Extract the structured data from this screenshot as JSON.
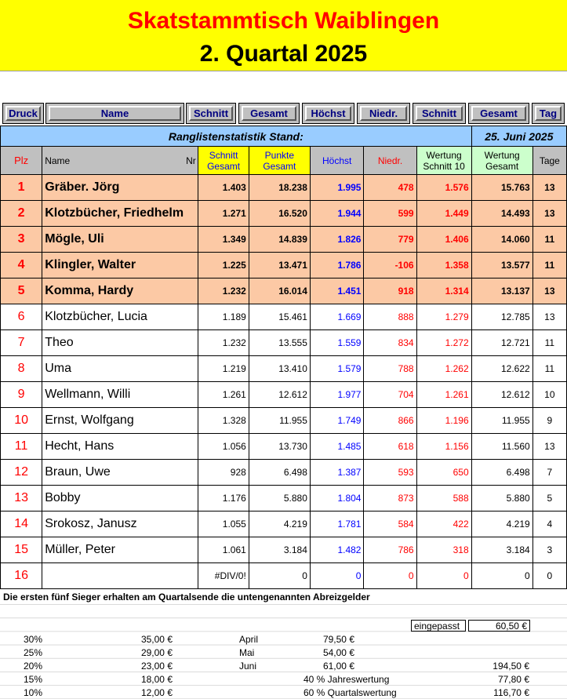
{
  "title": {
    "line1": "Skatstammtisch Waiblingen",
    "line2": "2. Quartal 2025"
  },
  "buttons": [
    "Druck",
    "Name",
    "Schnitt",
    "Gesamt",
    "Höchst",
    "Niedr.",
    "Schnitt",
    "Gesamt",
    "Tag"
  ],
  "stand": {
    "label": "Ranglistenstatistik Stand:",
    "date": "25. Juni 2025"
  },
  "headers": {
    "plz": "Plz",
    "name": "Name",
    "nr": "Nr",
    "schnitt": [
      "Schnitt",
      "Gesamt"
    ],
    "punkte": [
      "Punkte",
      "Gesamt"
    ],
    "hoechst": "Höchst",
    "niedr": "Niedr.",
    "wschnitt": [
      "Wertung",
      "Schnitt 10"
    ],
    "wgesamt": [
      "Wertung",
      "Gesamt"
    ],
    "tage": "Tage"
  },
  "colors": {
    "title_bg": "#ffff00",
    "title_red": "#ff0000",
    "header_blue": "#99ccff",
    "top5_bg": "#fcc9a5",
    "yellow": "#ffff00",
    "green": "#ccffcc"
  },
  "rows": [
    {
      "plz": "1",
      "name": "Gräber. Jörg",
      "schnitt": "1.403",
      "punkte": "18.238",
      "hoechst": "1.995",
      "niedr": "478",
      "wschnitt": "1.576",
      "wgesamt": "15.763",
      "tage": "13"
    },
    {
      "plz": "2",
      "name": "Klotzbücher, Friedhelm",
      "schnitt": "1.271",
      "punkte": "16.520",
      "hoechst": "1.944",
      "niedr": "599",
      "wschnitt": "1.449",
      "wgesamt": "14.493",
      "tage": "13"
    },
    {
      "plz": "3",
      "name": "Mögle, Uli",
      "schnitt": "1.349",
      "punkte": "14.839",
      "hoechst": "1.826",
      "niedr": "779",
      "wschnitt": "1.406",
      "wgesamt": "14.060",
      "tage": "11"
    },
    {
      "plz": "4",
      "name": "Klingler, Walter",
      "schnitt": "1.225",
      "punkte": "13.471",
      "hoechst": "1.786",
      "niedr": "-106",
      "wschnitt": "1.358",
      "wgesamt": "13.577",
      "tage": "11"
    },
    {
      "plz": "5",
      "name": "Komma, Hardy",
      "schnitt": "1.232",
      "punkte": "16.014",
      "hoechst": "1.451",
      "niedr": "918",
      "wschnitt": "1.314",
      "wgesamt": "13.137",
      "tage": "13"
    },
    {
      "plz": "6",
      "name": "Klotzbücher, Lucia",
      "schnitt": "1.189",
      "punkte": "15.461",
      "hoechst": "1.669",
      "niedr": "888",
      "wschnitt": "1.279",
      "wgesamt": "12.785",
      "tage": "13"
    },
    {
      "plz": "7",
      "name": "Theo",
      "schnitt": "1.232",
      "punkte": "13.555",
      "hoechst": "1.559",
      "niedr": "834",
      "wschnitt": "1.272",
      "wgesamt": "12.721",
      "tage": "11"
    },
    {
      "plz": "8",
      "name": "Uma",
      "schnitt": "1.219",
      "punkte": "13.410",
      "hoechst": "1.579",
      "niedr": "788",
      "wschnitt": "1.262",
      "wgesamt": "12.622",
      "tage": "11"
    },
    {
      "plz": "9",
      "name": "Wellmann, Willi",
      "schnitt": "1.261",
      "punkte": "12.612",
      "hoechst": "1.977",
      "niedr": "704",
      "wschnitt": "1.261",
      "wgesamt": "12.612",
      "tage": "10"
    },
    {
      "plz": "10",
      "name": "Ernst, Wolfgang",
      "schnitt": "1.328",
      "punkte": "11.955",
      "hoechst": "1.749",
      "niedr": "866",
      "wschnitt": "1.196",
      "wgesamt": "11.955",
      "tage": "9"
    },
    {
      "plz": "11",
      "name": "Hecht, Hans",
      "schnitt": "1.056",
      "punkte": "13.730",
      "hoechst": "1.485",
      "niedr": "618",
      "wschnitt": "1.156",
      "wgesamt": "11.560",
      "tage": "13"
    },
    {
      "plz": "12",
      "name": "Braun, Uwe",
      "schnitt": "928",
      "punkte": "6.498",
      "hoechst": "1.387",
      "niedr": "593",
      "wschnitt": "650",
      "wgesamt": "6.498",
      "tage": "7"
    },
    {
      "plz": "13",
      "name": "Bobby",
      "schnitt": "1.176",
      "punkte": "5.880",
      "hoechst": "1.804",
      "niedr": "873",
      "wschnitt": "588",
      "wgesamt": "5.880",
      "tage": "5"
    },
    {
      "plz": "14",
      "name": "Srokosz, Janusz",
      "schnitt": "1.055",
      "punkte": "4.219",
      "hoechst": "1.781",
      "niedr": "584",
      "wschnitt": "422",
      "wgesamt": "4.219",
      "tage": "4"
    },
    {
      "plz": "15",
      "name": "Müller, Peter",
      "schnitt": "1.061",
      "punkte": "3.184",
      "hoechst": "1.482",
      "niedr": "786",
      "wschnitt": "318",
      "wgesamt": "3.184",
      "tage": "3"
    },
    {
      "plz": "16",
      "name": "",
      "schnitt": "#DIV/0!",
      "punkte": "0",
      "hoechst": "0",
      "niedr": "0",
      "wschnitt": "0",
      "wgesamt": "0",
      "tage": "0"
    }
  ],
  "note": "Die ersten fünf Sieger erhalten am Quartalsende die untengenannten Abreizgelder",
  "payouts": [
    {
      "pct": "30%",
      "amount": "35,00 €"
    },
    {
      "pct": "25%",
      "amount": "29,00 €"
    },
    {
      "pct": "20%",
      "amount": "23,00 €"
    },
    {
      "pct": "15%",
      "amount": "18,00 €"
    },
    {
      "pct": "10%",
      "amount": "12,00 €"
    }
  ],
  "months": [
    {
      "month": "April",
      "amount": "79,50 €"
    },
    {
      "month": "Mai",
      "amount": "54,00 €"
    },
    {
      "month": "Juni",
      "amount": "61,00 €"
    }
  ],
  "eingepasst": {
    "label": "eingepasst",
    "value": "60,50 €"
  },
  "summary": [
    {
      "label": "",
      "value": "194,50 €"
    },
    {
      "label": "40 % Jahreswertung",
      "value": "77,80 €"
    },
    {
      "label": "60 % Quartalswertung",
      "value": "116,70 €"
    }
  ]
}
